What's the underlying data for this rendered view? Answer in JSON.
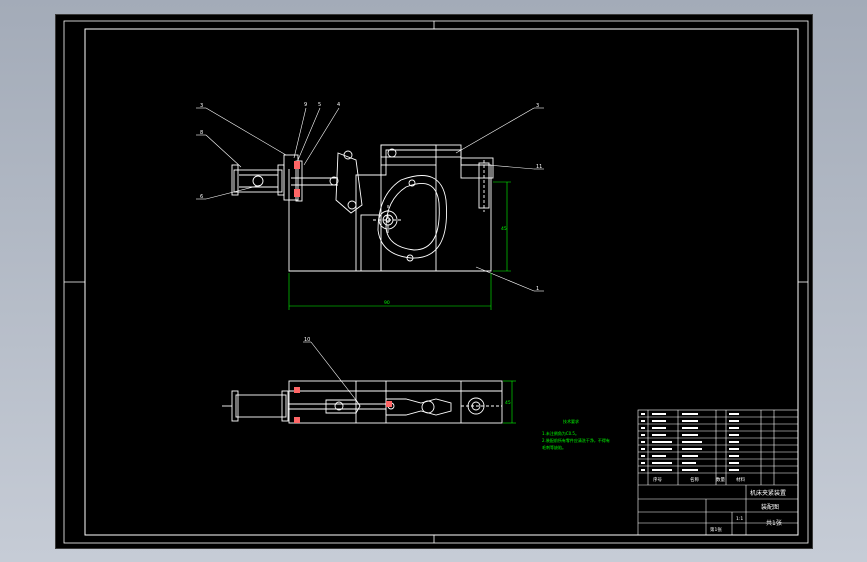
{
  "callouts": {
    "c3a": "3",
    "c8": "8",
    "c5": "5",
    "c4": "4",
    "c3b": "3",
    "c6": "6",
    "c9": "9",
    "c11": "11",
    "c1": "1",
    "c10": "10"
  },
  "dimensions": {
    "width": "90",
    "height": "45",
    "plan_height": "45"
  },
  "notes": {
    "title": "技术要求",
    "line1": "1.未注倒角为C0.5。",
    "line2": "2.装配前所有零件应清洗干净，不得有",
    "line3": "毛刺等缺陷。"
  },
  "title_block": {
    "part_name": "机床夹紧装置",
    "drawing_type": "装配图",
    "scale": "1:1",
    "seq_header": "序号",
    "name_header": "名称",
    "qty_header": "数量",
    "material_header": "材料",
    "sheet": "第1张",
    "company": "共1张"
  },
  "colors": {
    "background": "#000000",
    "lines": "#ffffff",
    "dimension": "#00ff00"
  }
}
